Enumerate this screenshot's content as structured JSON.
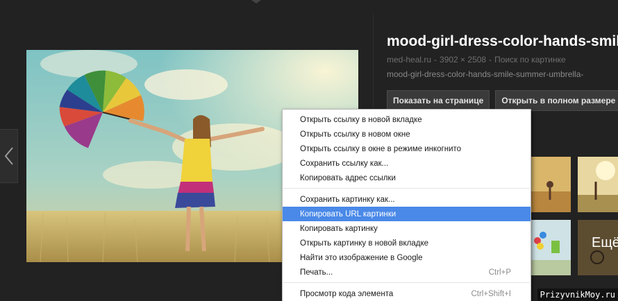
{
  "info": {
    "title": "mood-girl-dress-color-hands-smile-",
    "source": "med-heal.ru",
    "dimensions": "3902 × 2508",
    "search_link": "Поиск по картинке",
    "filename": "mood-girl-dress-color-hands-smile-summer-umbrella-",
    "btn_show": "Показать на странице",
    "btn_open": "Открыть в полном размере"
  },
  "related": {
    "more_label": "Ещё"
  },
  "context_menu": {
    "group1": [
      {
        "label": "Открыть ссылку в новой вкладке"
      },
      {
        "label": "Открыть ссылку в новом окне"
      },
      {
        "label": "Открыть ссылку в окне в режиме инкогнито"
      },
      {
        "label": "Сохранить ссылку как..."
      },
      {
        "label": "Копировать адрес ссылки"
      }
    ],
    "group2": [
      {
        "label": "Сохранить картинку как..."
      },
      {
        "label": "Копировать URL картинки",
        "highlighted": true
      },
      {
        "label": "Копировать картинку"
      },
      {
        "label": "Открыть картинку в новой вкладке"
      },
      {
        "label": "Найти это изображение в Google"
      },
      {
        "label": "Печать...",
        "shortcut": "Ctrl+P"
      }
    ],
    "group3": [
      {
        "label": "Просмотр кода элемента",
        "shortcut": "Ctrl+Shift+I"
      }
    ]
  },
  "watermark": "PrizyvnikMoy.ru",
  "colors": {
    "background": "#222222",
    "menu_highlight": "#4a89e8",
    "button_bg": "#3a3a3a"
  }
}
